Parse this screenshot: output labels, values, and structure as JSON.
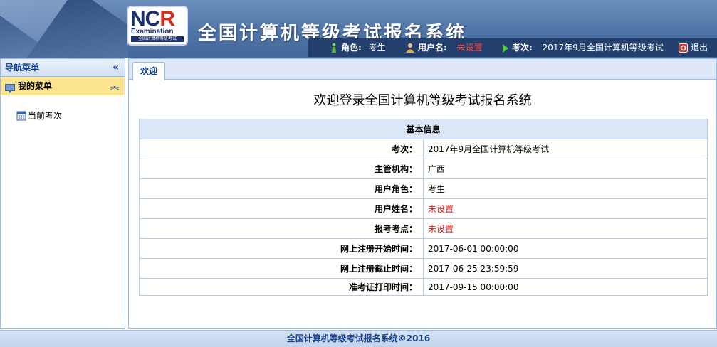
{
  "header": {
    "logo_text": "NCR",
    "logo_sub": "Examination",
    "logo_caption": "全国计算机等级考试",
    "system_title": "全国计算机等级考试报名系统",
    "role_label": "角色:",
    "role_value": "考生",
    "user_label": "用户名:",
    "user_value": "未设置",
    "exam_label": "考次:",
    "exam_value": "2017年9月全国计算机等级考试",
    "logout_label": "退出"
  },
  "nav": {
    "title": "导航菜单",
    "collapse_icon": "double-chevron-left",
    "menu_title": "我的菜单",
    "items": [
      {
        "label": "当前考次",
        "icon": "calendar-icon"
      }
    ]
  },
  "main": {
    "tab_label": "欢迎",
    "welcome": "欢迎登录全国计算机等级考试报名系统",
    "table_title": "基本信息",
    "rows": [
      {
        "key": "考次：",
        "value": "2017年9月全国计算机等级考试",
        "status": "normal"
      },
      {
        "key": "主管机构：",
        "value": "广西",
        "status": "normal"
      },
      {
        "key": "用户角色：",
        "value": "考生",
        "status": "normal"
      },
      {
        "key": "用户姓名：",
        "value": "未设置",
        "status": "warning"
      },
      {
        "key": "报考考点：",
        "value": "未设置",
        "status": "warning"
      },
      {
        "key": "网上注册开始时间：",
        "value": "2017-06-01 00:00:00",
        "status": "normal"
      },
      {
        "key": "网上注册截止时间：",
        "value": "2017-06-25 23:59:59",
        "status": "normal"
      },
      {
        "key": "准考证打印时间：",
        "value": "2017-09-15 00:00:00",
        "status": "normal"
      }
    ]
  },
  "footer": {
    "text": "全国计算机等级考试报名系统©2016"
  },
  "colors": {
    "header_bg": "#4f74a6",
    "info_bar_bg": "#233f6e",
    "accent_text": "#15428b",
    "warning_text": "#dd2222",
    "menu_highlight": "#fce48e"
  }
}
